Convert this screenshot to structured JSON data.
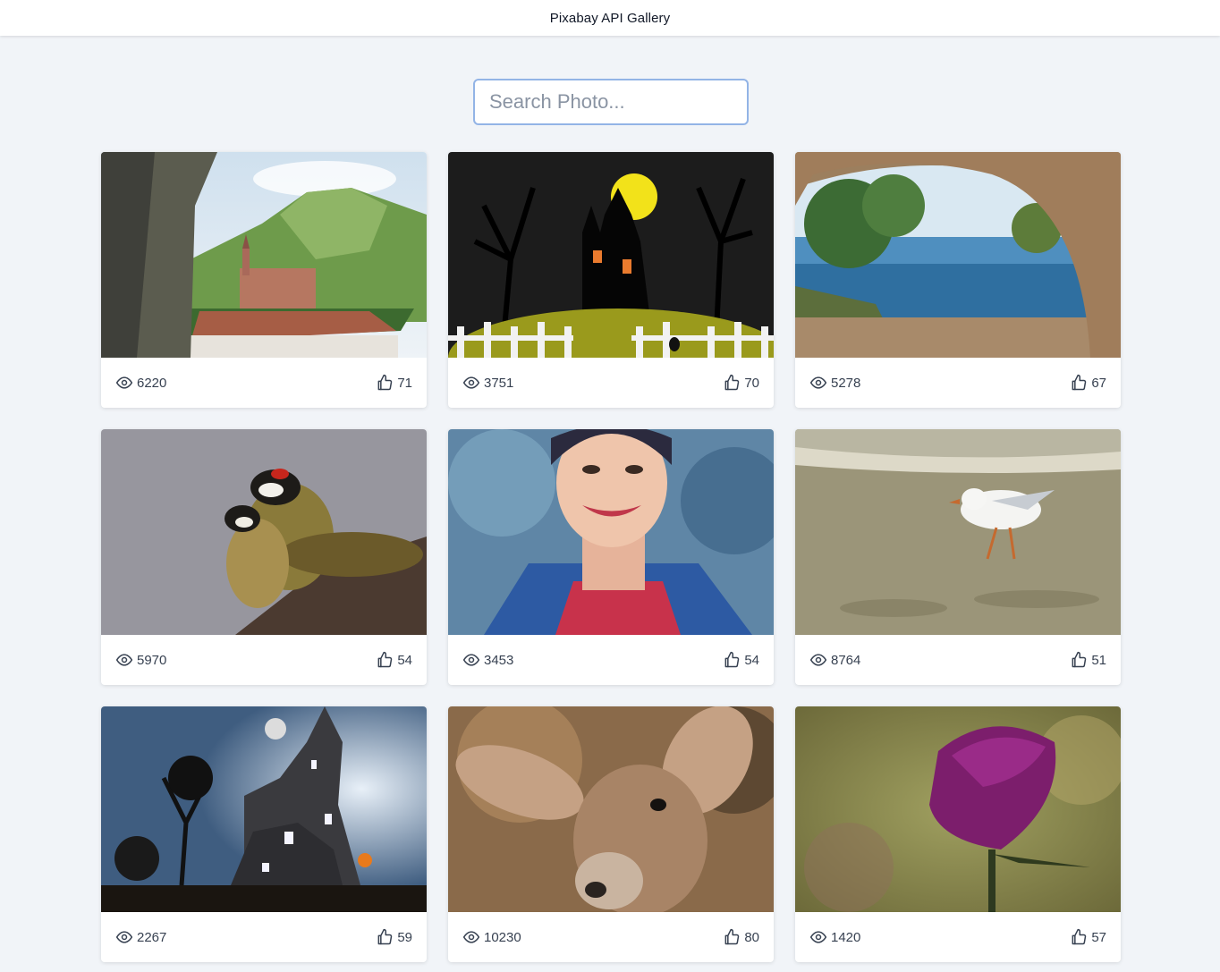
{
  "header": {
    "title": "Pixabay API Gallery"
  },
  "search": {
    "placeholder": "Search Photo...",
    "value": ""
  },
  "gallery": {
    "cards": [
      {
        "subject": "mountain-church-landscape",
        "views": "6220",
        "likes": "71"
      },
      {
        "subject": "halloween-haunted-house-illustration",
        "views": "3751",
        "likes": "70"
      },
      {
        "subject": "sea-bay-through-stone-arch",
        "views": "5278",
        "likes": "67"
      },
      {
        "subject": "two-woodpeckers",
        "views": "5970",
        "likes": "54"
      },
      {
        "subject": "painted-portrait-woman",
        "views": "3453",
        "likes": "54"
      },
      {
        "subject": "seagull-on-beach",
        "views": "8764",
        "likes": "51"
      },
      {
        "subject": "haunted-house-night",
        "views": "2267",
        "likes": "59"
      },
      {
        "subject": "deer-portrait",
        "views": "10230",
        "likes": "80"
      },
      {
        "subject": "purple-rose",
        "views": "1420",
        "likes": "57"
      }
    ]
  },
  "colors": {
    "background": "#f1f4f8",
    "card": "#ffffff",
    "search_border": "#93b4e6",
    "text": "#374151"
  },
  "icons": {
    "views": "eye-icon",
    "likes": "thumbs-up-icon"
  }
}
